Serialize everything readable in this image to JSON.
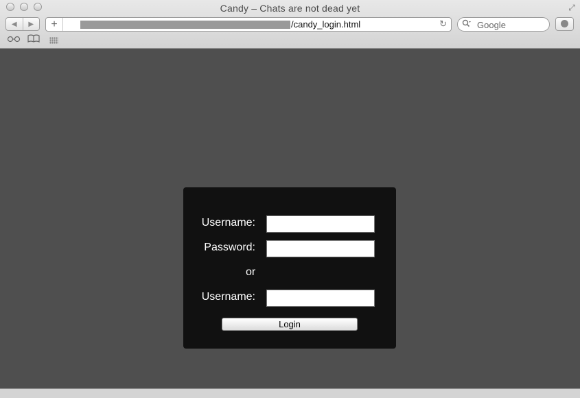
{
  "window": {
    "title": "Candy – Chats are not dead yet",
    "fullscreen_glyph": "⤢"
  },
  "toolbar": {
    "back_glyph": "◀",
    "forward_glyph": "▶",
    "add_glyph": "+",
    "url_visible": "/candy_login.html",
    "reload_glyph": "↻",
    "search_placeholder": "Google",
    "search_glyph": "🔍"
  },
  "bookmarks_bar": {
    "reading_list_glyph": "👓",
    "bookmarks_glyph": "📖"
  },
  "login_form": {
    "username_label": "Username:",
    "password_label": "Password:",
    "or_label": "or",
    "username2_label": "Username:",
    "username_value": "",
    "password_value": "",
    "username2_value": "",
    "login_button": "Login"
  },
  "colors": {
    "page_background": "#4f4f4f",
    "login_box_background": "#111111"
  }
}
